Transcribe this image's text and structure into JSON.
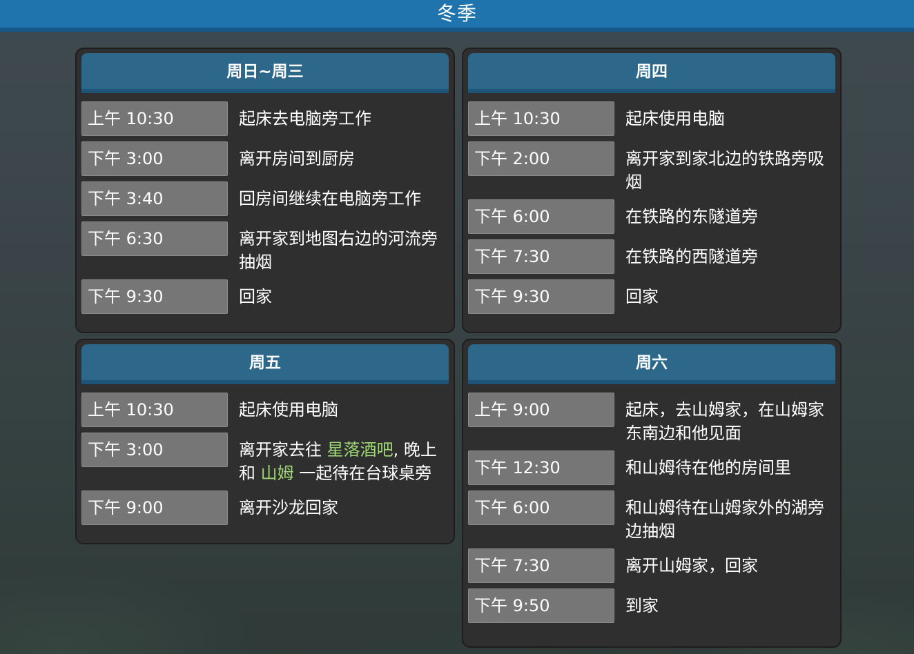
{
  "season": {
    "title": "冬季"
  },
  "colors": {
    "header_blue": "#1f74ad",
    "panel_header_blue": "#2d6789",
    "panel_bg": "#2f2f2f",
    "time_box_gray": "#767676",
    "highlight_green": "#9fd774"
  },
  "panels": [
    {
      "title": "周日~周三",
      "rows": [
        {
          "time": "上午 10:30",
          "text": "起床去电脑旁工作"
        },
        {
          "time": "下午 3:00",
          "text": "离开房间到厨房"
        },
        {
          "time": "下午 3:40",
          "text": "回房间继续在电脑旁工作"
        },
        {
          "time": "下午 6:30",
          "text": "离开家到地图右边的河流旁抽烟"
        },
        {
          "time": "下午 9:30",
          "text": "回家"
        }
      ]
    },
    {
      "title": "周四",
      "rows": [
        {
          "time": "上午 10:30",
          "text": "起床使用电脑"
        },
        {
          "time": "下午 2:00",
          "text": "离开家到家北边的铁路旁吸烟"
        },
        {
          "time": "下午 6:00",
          "text": "在铁路的东隧道旁"
        },
        {
          "time": "下午 7:30",
          "text": "在铁路的西隧道旁"
        },
        {
          "time": "下午 9:30",
          "text": "回家"
        }
      ]
    },
    {
      "title": "周五",
      "rows": [
        {
          "time": "上午 10:30",
          "text": "起床使用电脑"
        },
        {
          "time": "下午 3:00",
          "text_part1": "离开家去往 ",
          "link1": "星落酒吧",
          "text_part2": ", 晚上和 ",
          "link2": "山姆",
          "text_part3": " 一起待在台球桌旁"
        },
        {
          "time": "下午 9:00",
          "text": "离开沙龙回家"
        }
      ]
    },
    {
      "title": "周六",
      "rows": [
        {
          "time": "上午 9:00",
          "text": "起床，去山姆家，在山姆家东南边和他见面"
        },
        {
          "time": "下午 12:30",
          "text": "和山姆待在他的房间里"
        },
        {
          "time": "下午 6:00",
          "text": "和山姆待在山姆家外的湖旁边抽烟"
        },
        {
          "time": "下午 7:30",
          "text": "离开山姆家，回家"
        },
        {
          "time": "下午 9:50",
          "text": "到家"
        }
      ]
    }
  ]
}
